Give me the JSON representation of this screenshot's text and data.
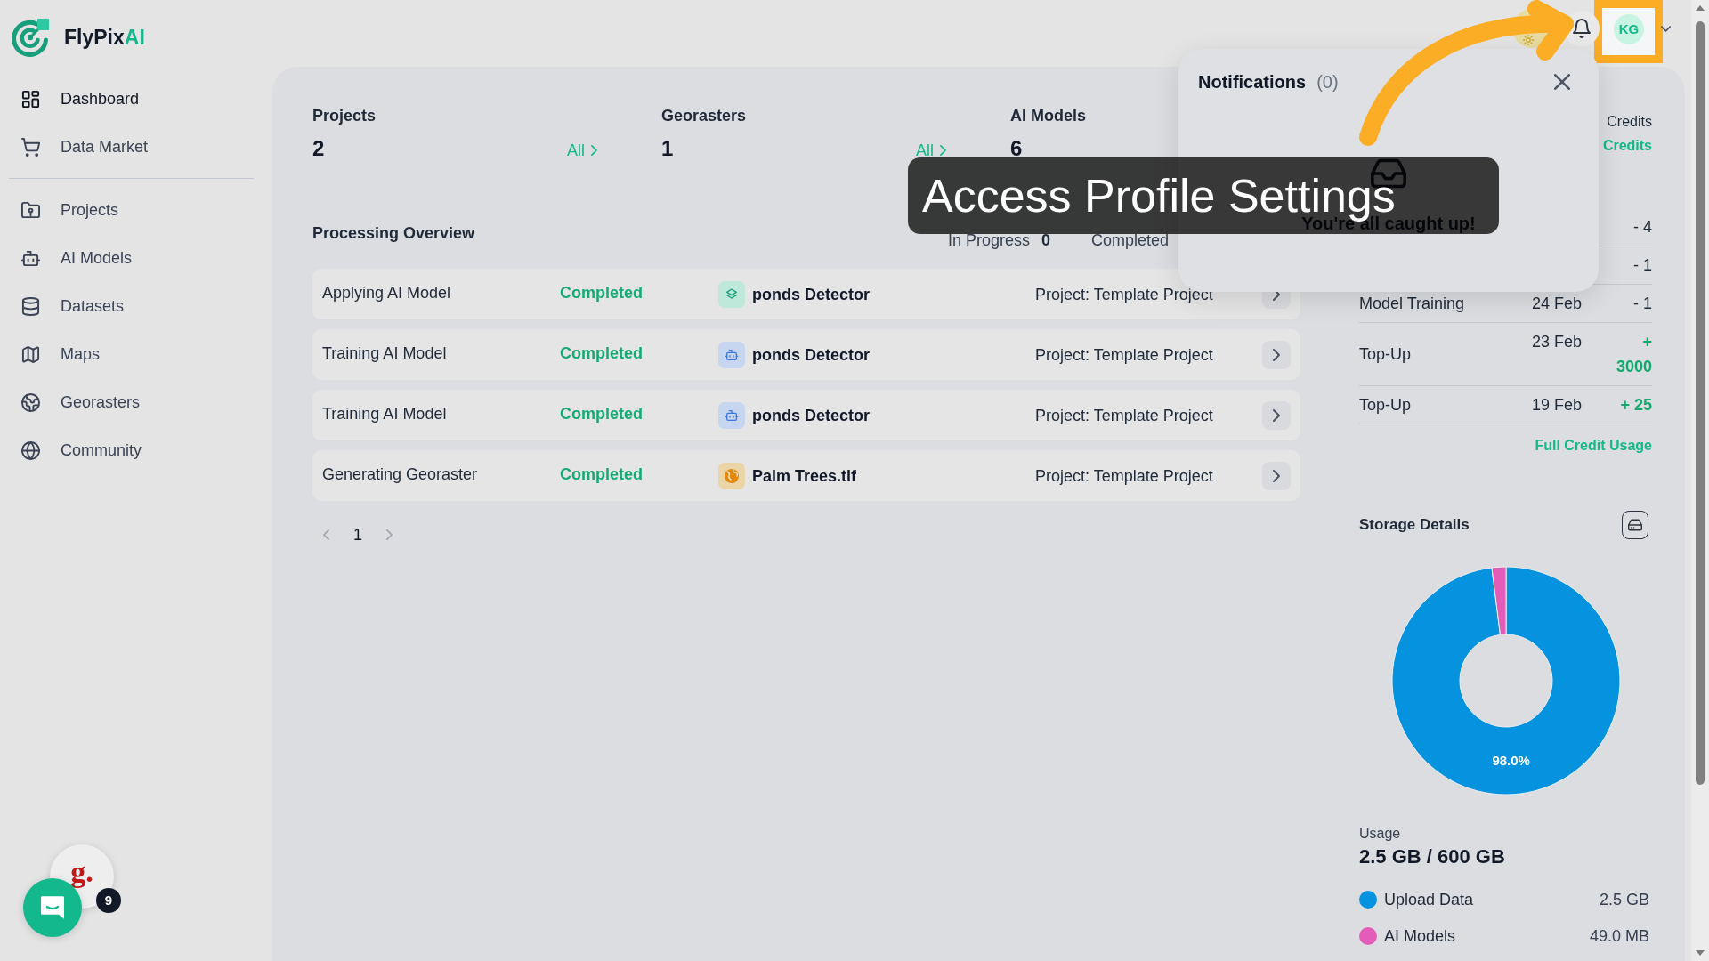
{
  "sidebar": {
    "logo": {
      "text": "FlyPix",
      "accent": "AI"
    },
    "groups": [
      {
        "items": [
          {
            "label": "Dashboard",
            "selected": true
          },
          {
            "label": "Data Market",
            "selected": false
          }
        ]
      },
      {
        "items": [
          {
            "label": "Projects",
            "selected": false
          },
          {
            "label": "AI Models",
            "selected": false
          },
          {
            "label": "Datasets",
            "selected": false
          },
          {
            "label": "Maps",
            "selected": false
          },
          {
            "label": "Georasters",
            "selected": false
          },
          {
            "label": "Community",
            "selected": false
          }
        ]
      }
    ]
  },
  "topbar": {
    "avatar": "KG"
  },
  "stats": [
    {
      "label": "Projects",
      "value": "2",
      "link": "All"
    },
    {
      "label": "Georasters",
      "value": "1",
      "link": "All"
    },
    {
      "label": "AI Models",
      "value": "6"
    }
  ],
  "processing": {
    "title": "Processing Overview",
    "counters": [
      {
        "label": "In Progress",
        "value": "0"
      },
      {
        "label": "Completed"
      }
    ],
    "rows": [
      {
        "action": "Applying AI Model",
        "status": "Completed",
        "kind": "apply",
        "name": "ponds Detector",
        "project": "Project: Template Project"
      },
      {
        "action": "Training AI Model",
        "status": "Completed",
        "kind": "train",
        "name": "ponds Detector",
        "project": "Project: Template Project"
      },
      {
        "action": "Training AI Model",
        "status": "Completed",
        "kind": "train",
        "name": "ponds Detector",
        "project": "Project: Template Project"
      },
      {
        "action": "Generating Georaster",
        "status": "Completed",
        "kind": "georaster",
        "name": "Palm Trees.tif",
        "project": "Project: Template Project"
      }
    ],
    "pages": [
      {
        "label": "1",
        "selected": true
      }
    ]
  },
  "credits": {
    "title": "Credits",
    "balance": "Credits",
    "transactions": [
      {
        "amount": "- 4",
        "kind": "debit"
      },
      {
        "amount": "- 1",
        "kind": "debit"
      },
      {
        "label": "Model Training",
        "date": "24 Feb",
        "amount": "- 1",
        "kind": "debit"
      },
      {
        "label": "Top-Up",
        "date": "23 Feb",
        "amount": "+ 3000",
        "kind": "credit"
      },
      {
        "label": "Top-Up",
        "date": "19 Feb",
        "amount": "+ 25",
        "kind": "credit"
      }
    ],
    "link": "Full Credit Usage"
  },
  "storage": {
    "title": "Storage Details",
    "chart_data": {
      "type": "donut",
      "categories": [
        "Upload Data",
        "AI Models"
      ],
      "values": [
        98.0,
        2.0
      ],
      "value_labels": [
        "98.0%",
        null
      ]
    },
    "usage_label": "Usage",
    "usage": "2.5 GB / 600 GB",
    "legend": [
      {
        "value": "2.5 GB",
        "color": "#0593e0"
      },
      {
        "value": "49.0 MB",
        "color": "#e35cb8"
      }
    ]
  },
  "notifications": {
    "title": "Notifications",
    "count": "(0)",
    "empty_text": "You're all caught up!"
  },
  "callout": {
    "text": "Access Profile Settings"
  },
  "chat": {
    "launcher_text": "g.",
    "badge": "9"
  }
}
